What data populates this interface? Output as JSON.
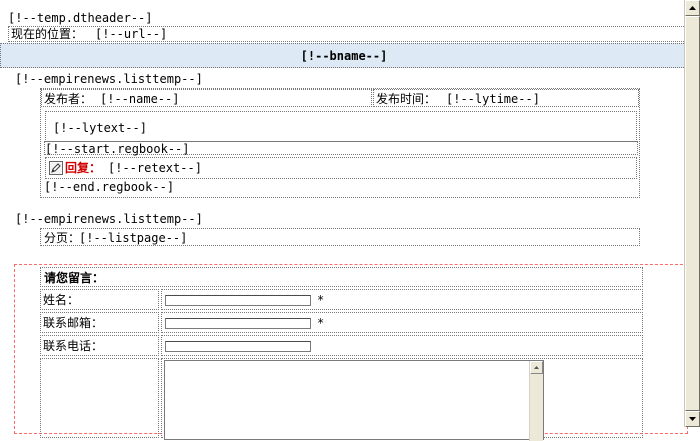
{
  "header_tag": "[!--temp.dtheader--]",
  "location": {
    "label": "现在的位置：",
    "value": "[!--url--]"
  },
  "bname": "[!--bname--]",
  "list_block": {
    "open_tag": "[!--empirenews.listtemp--]",
    "publisher": {
      "label": "发布者：",
      "value": "[!--name--]"
    },
    "publish_time": {
      "label": "发布时间：",
      "value": "[!--lytime--]"
    },
    "lytext": "[!--lytext--]",
    "start_regbook": "[!--start.regbook--]",
    "reply": {
      "label": "回复：",
      "value": "[!--retext--]",
      "icon": "edit-icon"
    },
    "end_regbook": "[!--end.regbook--]",
    "close_tag": "[!--empirenews.listtemp--]"
  },
  "pagination": {
    "label": "分页：",
    "value": "[!--listpage--]"
  },
  "form": {
    "title": "请您留言：",
    "name_label": "姓名：",
    "email_label": "联系邮箱：",
    "phone_label": "联系电话：",
    "required_mark": "*"
  },
  "colors": {
    "bname_bg": "#dde9f5",
    "reply_red": "#d00000",
    "form_border": "#ff6a6a"
  }
}
